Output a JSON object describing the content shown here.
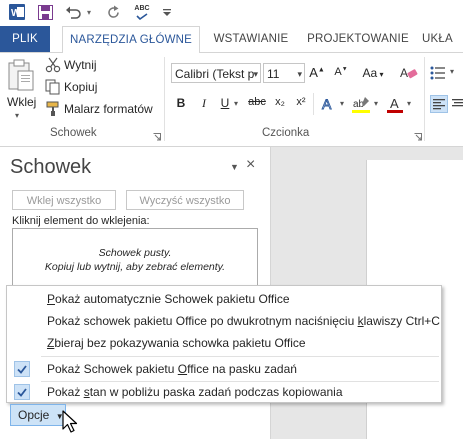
{
  "qat": {
    "word_icon": "word-icon",
    "save_icon": "save-icon",
    "undo_icon": "undo-icon",
    "redo_icon": "redo-icon",
    "spelling_icon": "spelling-check-icon",
    "customize_icon": "customize-qat-icon",
    "spelling_label": "ABC"
  },
  "tabs": {
    "file": "PLIK",
    "home": "NARZĘDZIA GŁÓWNE",
    "insert": "WSTAWIANIE",
    "design": "PROJEKTOWANIE",
    "layout": "UKŁA"
  },
  "ribbon": {
    "clipboard": {
      "paste_label": "Wklej",
      "cut_label": "Wytnij",
      "copy_label": "Kopiuj",
      "format_painter_label": "Malarz formatów",
      "group_label": "Schowek"
    },
    "font": {
      "font_name": "Calibri (Tekst p",
      "font_size": "11",
      "group_label": "Czcionka",
      "bold": "B",
      "italic": "I",
      "underline": "U",
      "strike": "abc",
      "subscript": "x₂",
      "superscript": "x²",
      "grow": "A",
      "shrink": "A",
      "case": "Aa",
      "font_color_glyph": "A",
      "highlight_glyph": "ab",
      "effects_glyph": "A"
    },
    "colors": {
      "highlight": "#ffff00",
      "font_color": "#c00000",
      "accent": "#2b579a"
    }
  },
  "pane": {
    "title": "Schowek",
    "paste_all": "Wklej wszystko",
    "clear_all": "Wyczyść wszystko",
    "instruction": "Kliknij element do wklejenia:",
    "empty_line1": "Schowek pusty.",
    "empty_line2": "Kopiuj lub wytnij, aby zebrać elementy."
  },
  "menu": {
    "items": [
      {
        "pre": "",
        "ul": "P",
        "post": "okaż automatycznie Schowek pakietu Office",
        "checked": false
      },
      {
        "pre": "Pokaż schowek pakietu Office po dwukrotnym naciśnięciu ",
        "ul": "k",
        "post": "lawiszy Ctrl+C",
        "checked": false
      },
      {
        "pre": "",
        "ul": "Z",
        "post": "bieraj bez pokazywania schowka pakietu Office",
        "checked": false
      },
      {
        "pre": "Pokaż Schowek pakietu ",
        "ul": "O",
        "post": "ffice na pasku zadań",
        "checked": true
      },
      {
        "pre": "Pokaż ",
        "ul": "s",
        "post": "tan w pobliżu paska zadań podczas kopiowania",
        "checked": true
      }
    ]
  },
  "options_button": {
    "label": "Opcje"
  }
}
